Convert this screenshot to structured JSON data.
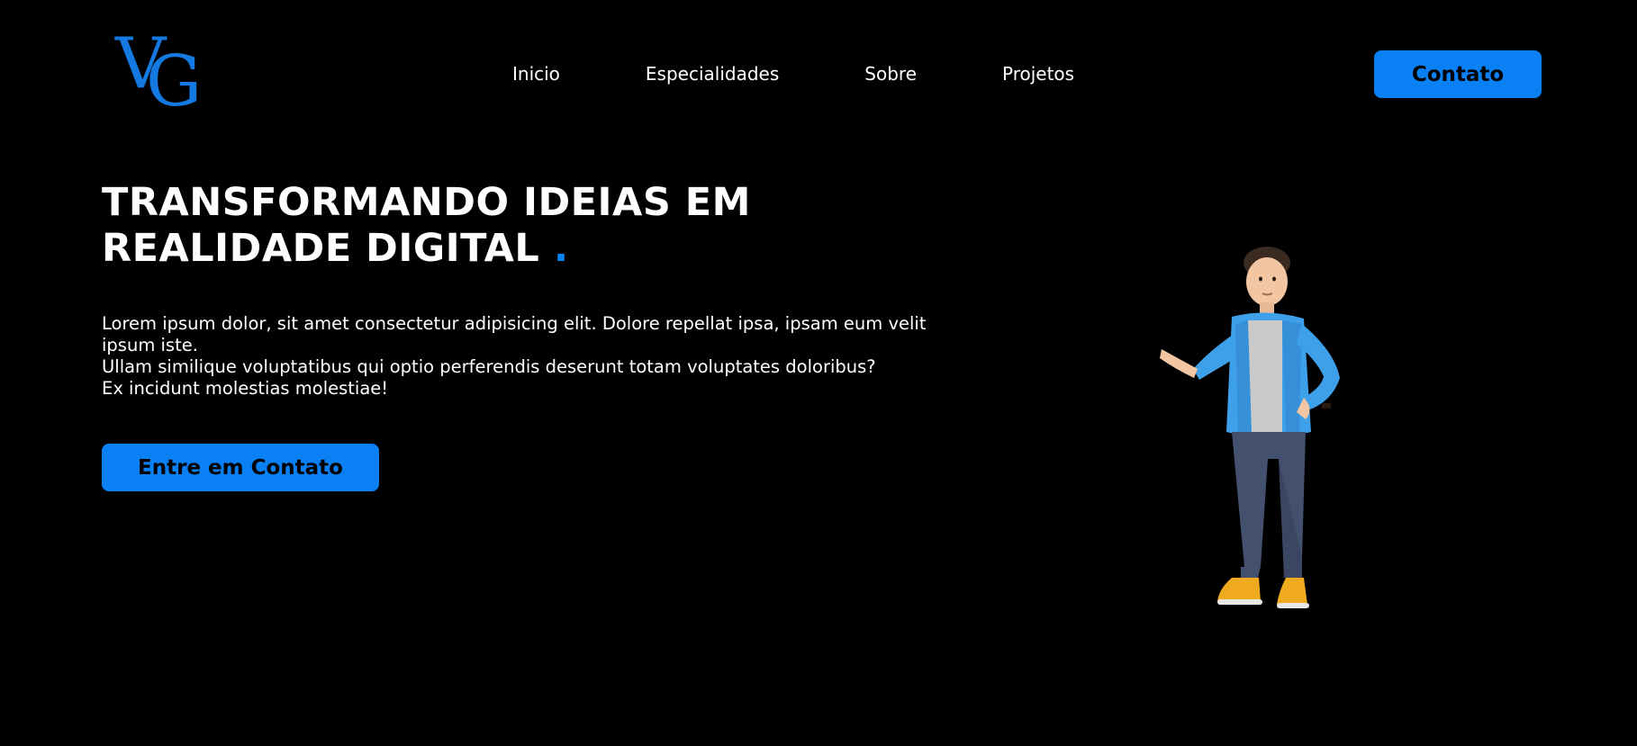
{
  "brand": {
    "logo_letter_1": "V",
    "logo_letter_2": "G",
    "accent_color": "#0a80f5"
  },
  "nav": {
    "items": [
      {
        "label": "Inicio"
      },
      {
        "label": "Especialidades"
      },
      {
        "label": "Sobre"
      },
      {
        "label": "Projetos"
      }
    ],
    "contact_button": "Contato"
  },
  "hero": {
    "title_line_1": "TRANSFORMANDO IDEIAS EM",
    "title_line_2": "REALIDADE DIGITAL",
    "title_dot": ".",
    "paragraph_line_1": "Lorem ipsum dolor, sit amet consectetur adipisicing elit. Dolore repellat ipsa, ipsam eum velit ipsum iste.",
    "paragraph_line_2": "Ullam similique voluptatibus qui optio perferendis deserunt totam voluptates doloribus?",
    "paragraph_line_3": "Ex incidunt molestias molestiae!",
    "cta_button": "Entre em Contato",
    "illustration": "3d-character-man-presenting"
  }
}
